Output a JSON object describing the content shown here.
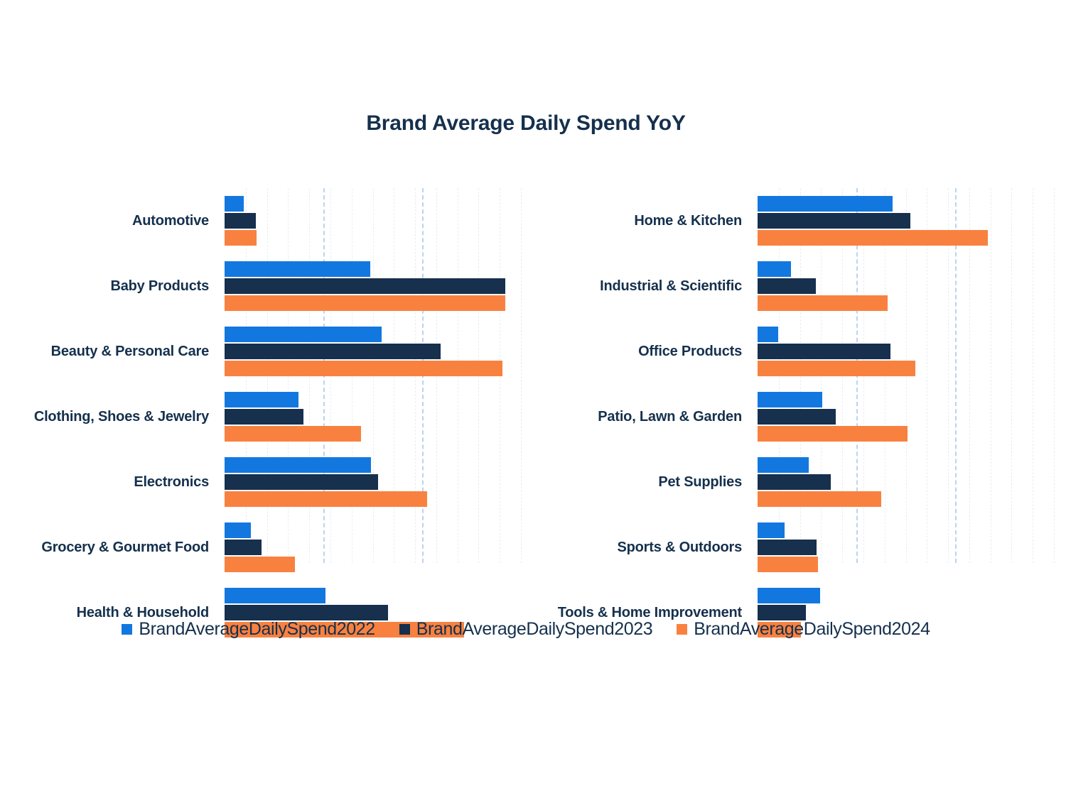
{
  "chart_data": {
    "type": "bar",
    "orientation": "horizontal",
    "title": "Brand Average Daily Spend YoY",
    "xlabel": "",
    "ylabel": "",
    "grid": true,
    "legend_position": "bottom",
    "xlim": [
      0,
      100
    ],
    "series": [
      {
        "name": "BrandAverageDailySpend2022",
        "color": "#1278e0"
      },
      {
        "name": "BrandAverageDailySpend2023",
        "color": "#16304d"
      },
      {
        "name": "BrandAverageDailySpend2024",
        "color": "#f98140"
      }
    ],
    "panels": [
      {
        "id": "left",
        "categories": [
          "Automotive",
          "Baby Products",
          "Beauty & Personal Care",
          "Clothing, Shoes & Jewelry",
          "Electronics",
          "Grocery & Gourmet Food",
          "Health & Household"
        ],
        "values": {
          "BrandAverageDailySpend2022": [
            6.5,
            49.2,
            53.0,
            25.0,
            49.4,
            8.9,
            34.1
          ],
          "BrandAverageDailySpend2023": [
            10.6,
            94.7,
            72.9,
            26.6,
            51.8,
            12.5,
            55.2
          ],
          "BrandAverageDailySpend2024": [
            10.8,
            94.7,
            93.8,
            46.0,
            68.3,
            23.7,
            80.8
          ]
        },
        "gridlines_minor": [
          7.1,
          14.3,
          21.4,
          28.6,
          35.7,
          42.9,
          50.0,
          57.1,
          64.3,
          71.4,
          78.6,
          85.7,
          92.9,
          100.0
        ],
        "gridlines_major": [
          33.3,
          66.7
        ]
      },
      {
        "id": "right",
        "categories": [
          "Home & Kitchen",
          "Industrial & Scientific",
          "Office Products",
          "Patio, Lawn & Garden",
          "Pet Supplies",
          "Sports & Outdoors",
          "Tools & Home Improvement"
        ],
        "values": {
          "BrandAverageDailySpend2022": [
            45.6,
            11.3,
            7.0,
            21.8,
            17.3,
            9.1,
            21.1
          ],
          "BrandAverageDailySpend2023": [
            51.6,
            19.7,
            44.8,
            26.4,
            24.7,
            19.9,
            16.3
          ],
          "BrandAverageDailySpend2024": [
            77.7,
            43.9,
            53.2,
            50.6,
            41.7,
            20.4,
            14.6
          ]
        },
        "gridlines_minor": [
          7.1,
          14.3,
          21.4,
          28.6,
          35.7,
          42.9,
          50.0,
          57.1,
          64.3,
          71.4,
          78.6,
          85.7,
          92.9,
          100.0
        ],
        "gridlines_major": [
          33.3,
          66.7
        ]
      }
    ]
  },
  "legend": {
    "items": [
      {
        "label": "BrandAverageDailySpend2022",
        "color": "#1278e0"
      },
      {
        "label": "BrandAverageDailySpend2023",
        "color": "#16304d"
      },
      {
        "label": "BrandAverageDailySpend2024",
        "color": "#f98140"
      }
    ]
  },
  "colors": {
    "series_2022": "#1278e0",
    "series_2023": "#16304d",
    "series_2024": "#f98140",
    "title_text": "#15304d",
    "label_text": "#15304d",
    "gridline_minor": "#e9eef3",
    "gridline_major": "#b9d4f0",
    "background": "#ffffff"
  }
}
